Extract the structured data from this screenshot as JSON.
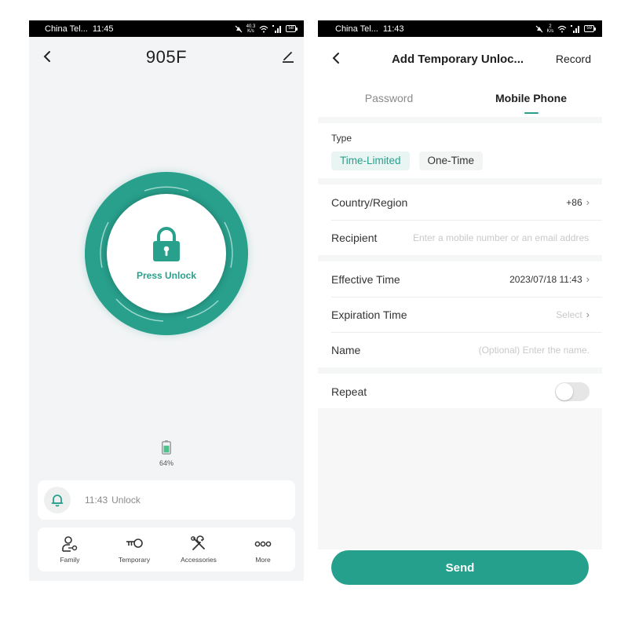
{
  "left_screen": {
    "status_bar": {
      "carrier": "China Tel...",
      "time": "11:45",
      "net_speed_top": "40.3",
      "net_speed_bottom": "K/s",
      "signal_badge": "5G",
      "battery": "58"
    },
    "header": {
      "back_icon": "chevron-left-icon",
      "title": "905F",
      "edit_icon": "pencil-icon"
    },
    "unlock_button": {
      "icon": "padlock-icon",
      "label": "Press Unlock"
    },
    "lock_battery": {
      "icon": "battery-icon",
      "percent_text": "64%",
      "level": 0.64
    },
    "recent_activity": {
      "icon": "bell-icon",
      "time": "11:43",
      "text": "Unlock"
    },
    "shortcuts": [
      {
        "icon": "family-key-icon",
        "label": "Family"
      },
      {
        "icon": "key-icon",
        "label": "Temporary"
      },
      {
        "icon": "tools-icon",
        "label": "Accessories"
      },
      {
        "icon": "more-dots-icon",
        "label": "More"
      }
    ]
  },
  "right_screen": {
    "status_bar": {
      "carrier": "China Tel...",
      "time": "11:43",
      "net_speed_top": "2",
      "net_speed_bottom": "K/s",
      "signal_badge": "5G",
      "battery": "59"
    },
    "header": {
      "back_icon": "chevron-left-icon",
      "title": "Add Temporary Unloc...",
      "record_label": "Record"
    },
    "tabs": [
      {
        "label": "Password",
        "active": false
      },
      {
        "label": "Mobile Phone",
        "active": true
      }
    ],
    "type": {
      "label": "Type",
      "options": [
        {
          "label": "Time-Limited",
          "selected": true
        },
        {
          "label": "One-Time",
          "selected": false
        }
      ]
    },
    "recipient_section": {
      "country": {
        "label": "Country/Region",
        "value": "+86"
      },
      "recipient": {
        "label": "Recipient",
        "value": "",
        "placeholder": "Enter a mobile number or an email address"
      }
    },
    "time_section": {
      "effective": {
        "label": "Effective Time",
        "value": "2023/07/18 11:43"
      },
      "expiration": {
        "label": "Expiration Time",
        "placeholder": "Select"
      },
      "name": {
        "label": "Name",
        "value": "",
        "placeholder": "(Optional) Enter the name."
      }
    },
    "repeat": {
      "label": "Repeat",
      "enabled": false
    },
    "send_label": "Send"
  },
  "colors": {
    "accent": "#28a08c",
    "accent_light": "#e8f5f2",
    "page_bg": "#f3f4f6"
  }
}
